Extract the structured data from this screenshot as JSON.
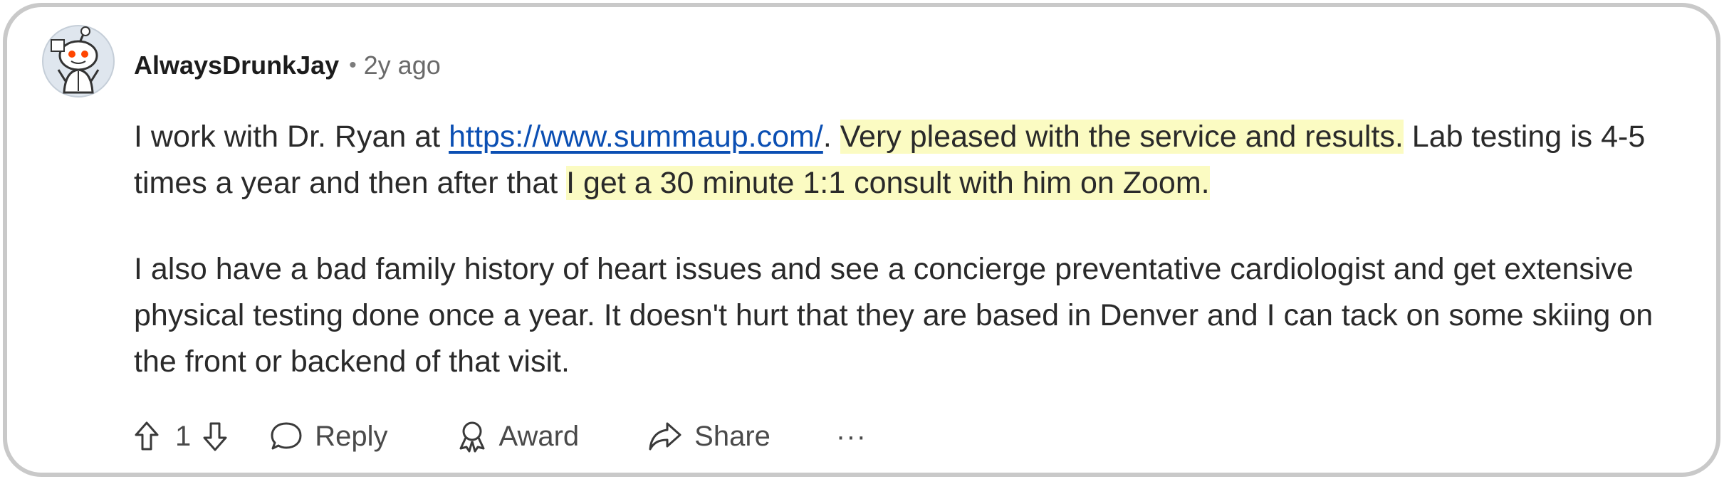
{
  "comment": {
    "author": "AlwaysDrunkJay",
    "separator": "•",
    "age": "2y ago",
    "paragraph1": {
      "t1": "I work with Dr. Ryan at ",
      "link": "https://www.summaup.com/",
      "t2": ". ",
      "highlight1": "Very pleased with the service and results.",
      "t3": " Lab testing is 4-5 times a year and then after that ",
      "highlight2": "I get a 30 minute 1:1 consult with him on Zoom."
    },
    "paragraph2": "I also have a bad family history of heart issues and see a concierge preventative cardiologist and get extensive physical testing done once a year. It doesn't hurt that they are based in Denver and I can tack on some skiing on the front or backend of that visit."
  },
  "actions": {
    "vote_count": "1",
    "reply_label": "Reply",
    "award_label": "Award",
    "share_label": "Share",
    "more_label": "···"
  },
  "colors": {
    "highlight": "#fbfbc2",
    "link": "#0b4fb3",
    "border": "#c9c9c9"
  }
}
